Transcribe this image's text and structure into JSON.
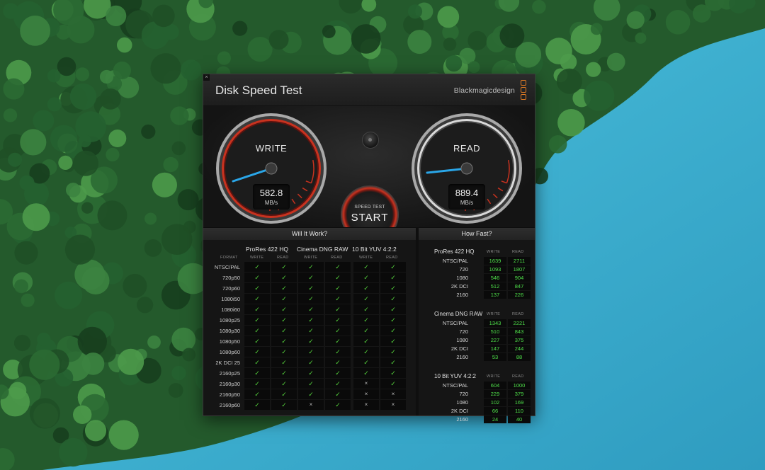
{
  "window": {
    "title": "Disk Speed Test",
    "brand": "Blackmagicdesign",
    "close_symbol": "×"
  },
  "gauges": {
    "write": {
      "label": "WRITE",
      "value": "582.8",
      "unit": "MB/s"
    },
    "read": {
      "label": "READ",
      "value": "889.4",
      "unit": "MB/s"
    }
  },
  "start_button": {
    "small": "SPEED TEST",
    "big": "START"
  },
  "will_it_work": {
    "title": "Will It Work?",
    "format_label": "FORMAT",
    "groups": [
      "ProRes 422 HQ",
      "Cinema DNG RAW",
      "10 Bit YUV 4:2:2"
    ],
    "sub_labels": [
      "WRITE",
      "READ"
    ],
    "ok_symbol": "✓",
    "no_symbol": "×",
    "rows": [
      {
        "format": "NTSC/PAL",
        "cells": [
          1,
          1,
          1,
          1,
          1,
          1
        ]
      },
      {
        "format": "720p50",
        "cells": [
          1,
          1,
          1,
          1,
          1,
          1
        ]
      },
      {
        "format": "720p60",
        "cells": [
          1,
          1,
          1,
          1,
          1,
          1
        ]
      },
      {
        "format": "1080i50",
        "cells": [
          1,
          1,
          1,
          1,
          1,
          1
        ]
      },
      {
        "format": "1080i60",
        "cells": [
          1,
          1,
          1,
          1,
          1,
          1
        ]
      },
      {
        "format": "1080p25",
        "cells": [
          1,
          1,
          1,
          1,
          1,
          1
        ]
      },
      {
        "format": "1080p30",
        "cells": [
          1,
          1,
          1,
          1,
          1,
          1
        ]
      },
      {
        "format": "1080p50",
        "cells": [
          1,
          1,
          1,
          1,
          1,
          1
        ]
      },
      {
        "format": "1080p60",
        "cells": [
          1,
          1,
          1,
          1,
          1,
          1
        ]
      },
      {
        "format": "2K DCI 25",
        "cells": [
          1,
          1,
          1,
          1,
          1,
          1
        ]
      },
      {
        "format": "2160p25",
        "cells": [
          1,
          1,
          1,
          1,
          1,
          1
        ]
      },
      {
        "format": "2160p30",
        "cells": [
          1,
          1,
          1,
          1,
          0,
          1
        ]
      },
      {
        "format": "2160p50",
        "cells": [
          1,
          1,
          1,
          1,
          0,
          0
        ]
      },
      {
        "format": "2160p60",
        "cells": [
          1,
          1,
          0,
          1,
          0,
          0
        ]
      }
    ]
  },
  "how_fast": {
    "title": "How Fast?",
    "sub_labels": [
      "WRITE",
      "READ"
    ],
    "groups": [
      {
        "name": "ProRes 422 HQ",
        "rows": [
          {
            "format": "NTSC/PAL",
            "write": "1639",
            "read": "2711"
          },
          {
            "format": "720",
            "write": "1093",
            "read": "1807"
          },
          {
            "format": "1080",
            "write": "546",
            "read": "904"
          },
          {
            "format": "2K DCI",
            "write": "512",
            "read": "847"
          },
          {
            "format": "2160",
            "write": "137",
            "read": "226"
          }
        ]
      },
      {
        "name": "Cinema DNG RAW",
        "rows": [
          {
            "format": "NTSC/PAL",
            "write": "1343",
            "read": "2221"
          },
          {
            "format": "720",
            "write": "510",
            "read": "843"
          },
          {
            "format": "1080",
            "write": "227",
            "read": "375"
          },
          {
            "format": "2K DCI",
            "write": "147",
            "read": "244"
          },
          {
            "format": "2160",
            "write": "53",
            "read": "88"
          }
        ]
      },
      {
        "name": "10 Bit YUV 4:2:2",
        "rows": [
          {
            "format": "NTSC/PAL",
            "write": "604",
            "read": "1000"
          },
          {
            "format": "720",
            "write": "229",
            "read": "379"
          },
          {
            "format": "1080",
            "write": "102",
            "read": "169"
          },
          {
            "format": "2K DCI",
            "write": "66",
            "read": "110"
          },
          {
            "format": "2160",
            "write": "24",
            "read": "40"
          }
        ]
      }
    ]
  },
  "colors": {
    "accent_red": "#c8321f",
    "needle_blue": "#2aa6e8",
    "ok_green": "#55d23c",
    "number_green": "#4fe04a",
    "brand_orange": "#e07b24",
    "water": "#38aacb",
    "forest": "#245a2c"
  }
}
